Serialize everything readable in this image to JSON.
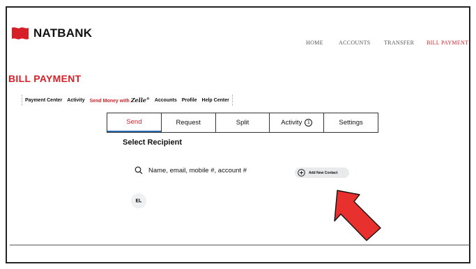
{
  "brand": {
    "name": "NATBANK",
    "accent_color": "#d71f27"
  },
  "top_nav": {
    "items": [
      {
        "label": "HOME"
      },
      {
        "label": "ACCOUNTS"
      },
      {
        "label": "TRANSFER"
      },
      {
        "label": "BILL PAYMENT",
        "active": true
      }
    ]
  },
  "page": {
    "title": "BILL PAYMENT"
  },
  "sub_nav": {
    "items": [
      {
        "label": "Payment Center"
      },
      {
        "label": "Activity"
      },
      {
        "label_prefix": "Send Money with ",
        "zelle": "Zelle",
        "zelle_mark": "®",
        "active": true
      },
      {
        "label": "Accounts"
      },
      {
        "label": "Profile"
      },
      {
        "label": "Help Center"
      }
    ]
  },
  "tabs": {
    "items": [
      {
        "label": "Send",
        "active": true
      },
      {
        "label": "Request"
      },
      {
        "label": "Split"
      },
      {
        "label": "Activity",
        "badge": "1"
      },
      {
        "label": "Settings"
      }
    ]
  },
  "recipient": {
    "title": "Select Recipient",
    "search_placeholder": "Name, email, mobile #, account #",
    "add_contact_label": "Add New Contact",
    "recent_contacts": [
      {
        "initials": "EL"
      }
    ]
  },
  "icons": {
    "logo": "natbank-flag-logo",
    "search": "search-icon",
    "add": "plus-circle-icon",
    "annotation": "red-arrow-pointer"
  }
}
